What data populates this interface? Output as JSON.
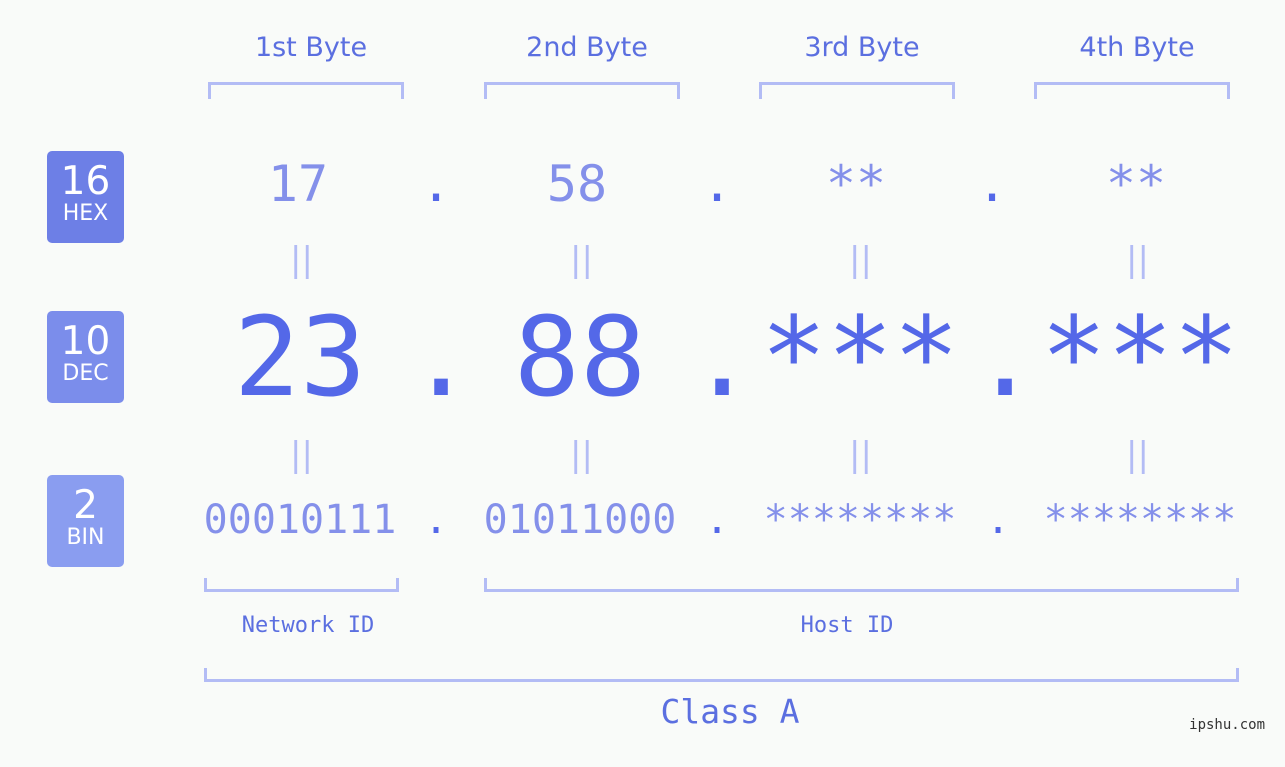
{
  "bytes": [
    {
      "label": "1st Byte",
      "hex": "17",
      "dec": "23",
      "bin": "00010111"
    },
    {
      "label": "2nd Byte",
      "hex": "58",
      "dec": "88",
      "bin": "01011000"
    },
    {
      "label": "3rd Byte",
      "hex": "**",
      "dec": "***",
      "bin": "********"
    },
    {
      "label": "4th Byte",
      "hex": "**",
      "dec": "***",
      "bin": "********"
    }
  ],
  "separator": ".",
  "equals": "||",
  "badges": {
    "hex": {
      "num": "16",
      "label": "HEX",
      "color": "#6d7fe6"
    },
    "dec": {
      "num": "10",
      "label": "DEC",
      "color": "#7b8deb"
    },
    "bin": {
      "num": "2",
      "label": "BIN",
      "color": "#8a9df0"
    }
  },
  "sections": {
    "network": "Network ID",
    "host": "Host ID",
    "class": "Class A"
  },
  "watermark": "ipshu.com"
}
